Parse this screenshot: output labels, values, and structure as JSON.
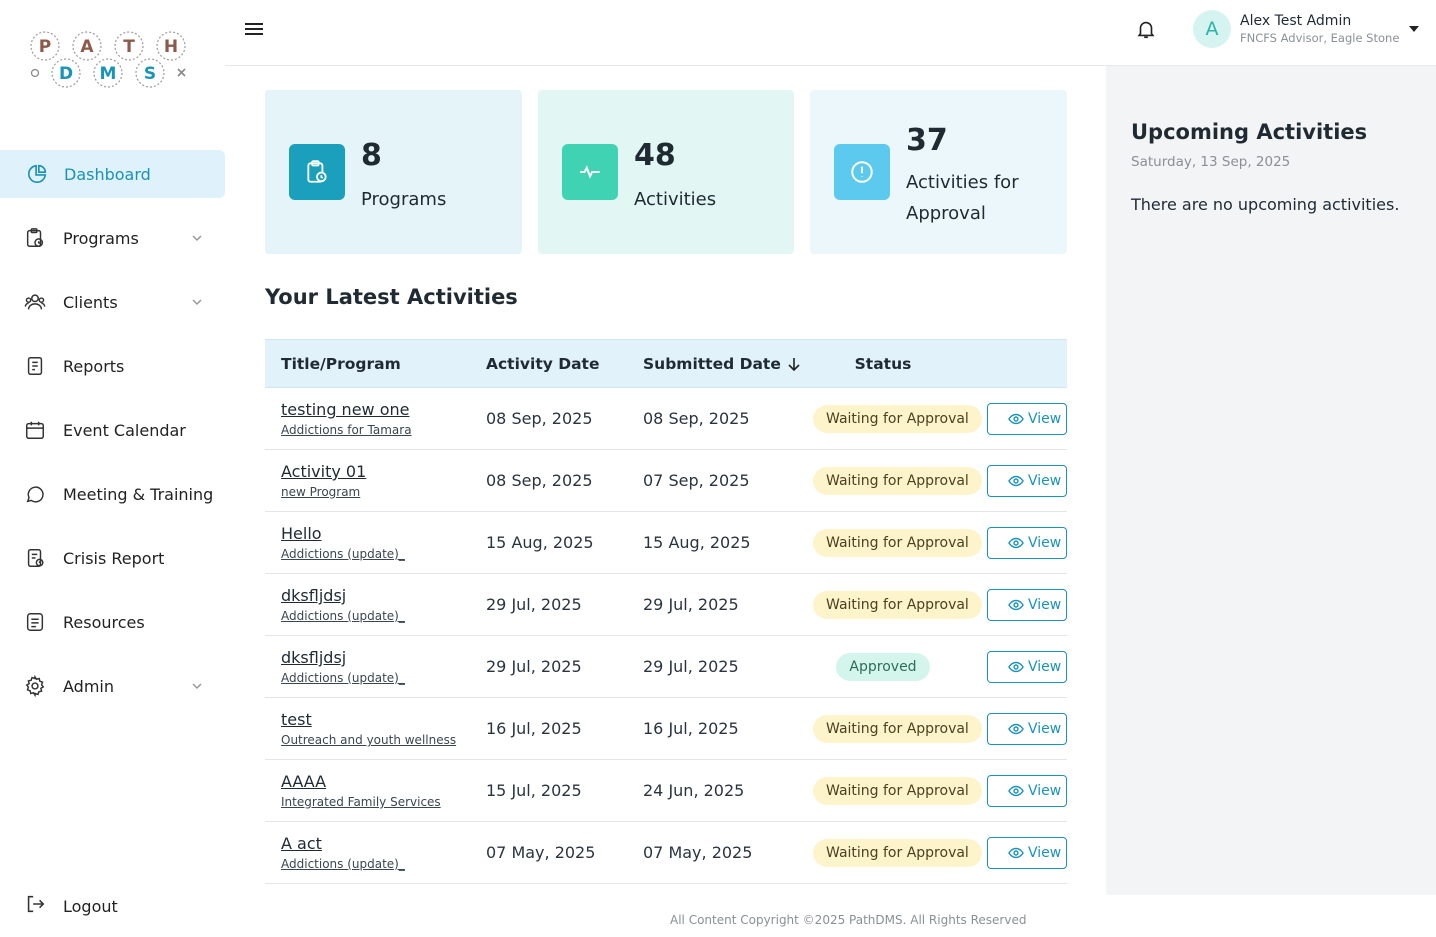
{
  "brand": {
    "logo_letters": [
      "P",
      "A",
      "T",
      "H",
      "D",
      "M",
      "S"
    ]
  },
  "header": {
    "user_initial": "A",
    "user_name": "Alex Test Admin",
    "user_role": "FNCFS Advisor, Eagle Stone"
  },
  "sidebar": {
    "items": [
      {
        "label": "Dashboard",
        "icon": "pie-chart-icon",
        "active": true
      },
      {
        "label": "Programs",
        "icon": "clipboard-clock-icon",
        "expandable": true
      },
      {
        "label": "Clients",
        "icon": "users-icon",
        "expandable": true
      },
      {
        "label": "Reports",
        "icon": "document-icon"
      },
      {
        "label": "Event Calendar",
        "icon": "calendar-icon"
      },
      {
        "label": "Meeting & Training",
        "icon": "chat-bubble-icon"
      },
      {
        "label": "Crisis Report",
        "icon": "crisis-document-icon"
      },
      {
        "label": "Resources",
        "icon": "resources-icon"
      },
      {
        "label": "Admin",
        "icon": "gear-icon",
        "expandable": true
      }
    ],
    "logout_label": "Logout"
  },
  "stats": [
    {
      "value": "8",
      "label": "Programs",
      "bg": "#e4f4f8",
      "icon_bg": "#1a9fbd"
    },
    {
      "value": "48",
      "label": "Activities",
      "bg": "#e2f7f3",
      "icon_bg": "#3fd3b3"
    },
    {
      "value": "37",
      "label": "Activities for Approval",
      "bg": "#ecf7fb",
      "icon_bg": "#5cc9ef"
    }
  ],
  "latest": {
    "title": "Your Latest Activities",
    "columns": [
      "Title/Program",
      "Activity Date",
      "Submitted Date",
      "Status"
    ],
    "view_label": "View",
    "rows": [
      {
        "title": "testing new one",
        "program": "Addictions for Tamara",
        "activity_date": "08 Sep, 2025",
        "submitted_date": "08 Sep, 2025",
        "status": "Waiting for Approval"
      },
      {
        "title": "Activity 01",
        "program": "new Program",
        "activity_date": "08 Sep, 2025",
        "submitted_date": "07 Sep, 2025",
        "status": "Waiting for Approval"
      },
      {
        "title": "Hello",
        "program": "Addictions (update)_",
        "activity_date": "15 Aug, 2025",
        "submitted_date": "15 Aug, 2025",
        "status": "Waiting for Approval"
      },
      {
        "title": "dksfljdsj",
        "program": "Addictions (update)_",
        "activity_date": "29 Jul, 2025",
        "submitted_date": "29 Jul, 2025",
        "status": "Waiting for Approval"
      },
      {
        "title": "dksfljdsj",
        "program": "Addictions (update)_",
        "activity_date": "29 Jul, 2025",
        "submitted_date": "29 Jul, 2025",
        "status": "Approved"
      },
      {
        "title": "test",
        "program": "Outreach and youth wellness",
        "activity_date": "16 Jul, 2025",
        "submitted_date": "16 Jul, 2025",
        "status": "Waiting for Approval"
      },
      {
        "title": "AAAA",
        "program": "Integrated Family Services",
        "activity_date": "15 Jul, 2025",
        "submitted_date": "24 Jun, 2025",
        "status": "Waiting for Approval"
      },
      {
        "title": "A act",
        "program": "Addictions (update)_",
        "activity_date": "07 May, 2025",
        "submitted_date": "07 May, 2025",
        "status": "Waiting for Approval"
      }
    ]
  },
  "upcoming": {
    "title": "Upcoming Activities",
    "date": "Saturday, 13 Sep, 2025",
    "empty_text": "There are no upcoming activities."
  },
  "footer": {
    "text": "All Content Copyright ©2025 PathDMS. All Rights Reserved"
  }
}
